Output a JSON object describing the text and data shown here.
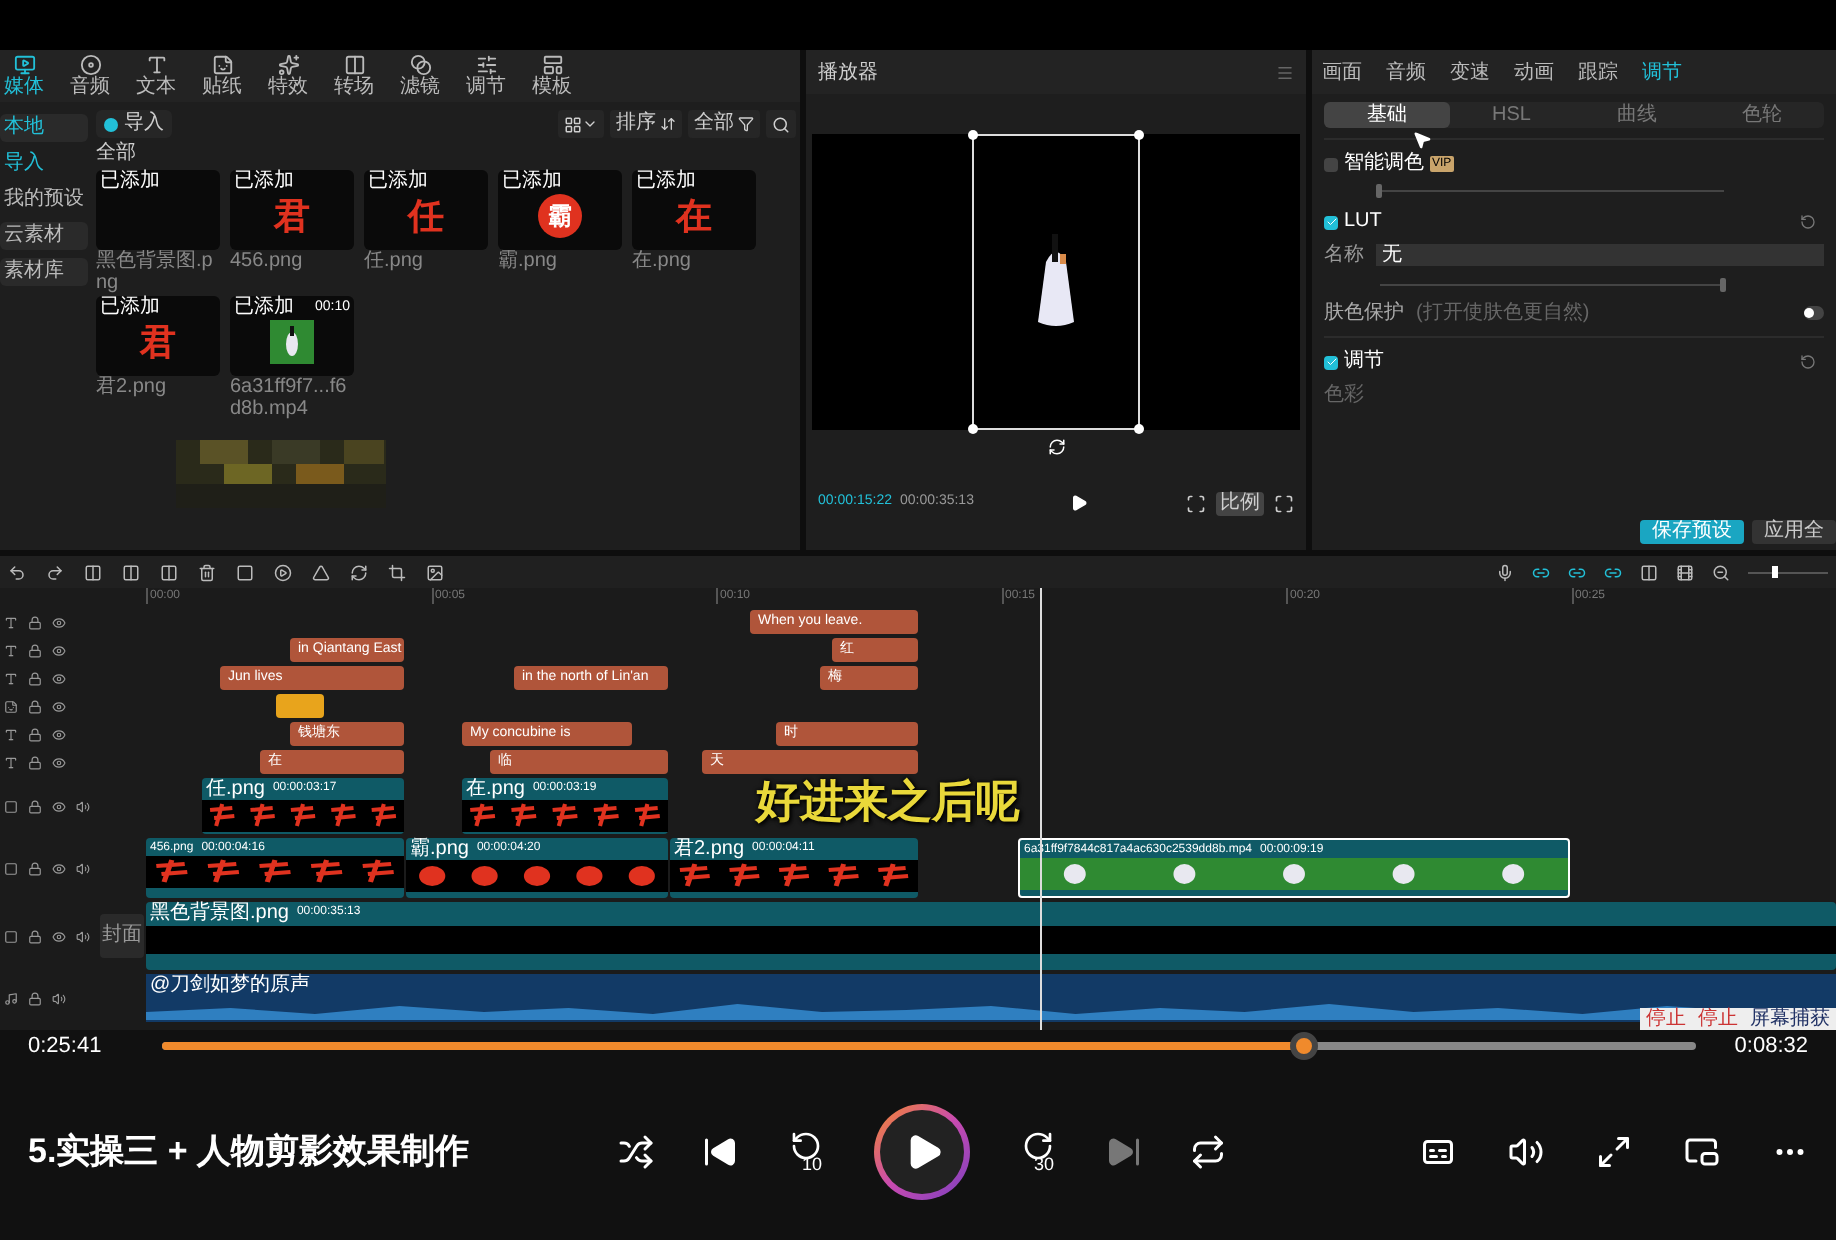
{
  "editor": {
    "media_panel": {
      "tabs": [
        {
          "label": "媒体",
          "selected": true
        },
        {
          "label": "音频",
          "selected": false
        },
        {
          "label": "文本",
          "selected": false
        },
        {
          "label": "贴纸",
          "selected": false
        },
        {
          "label": "特效",
          "selected": false
        },
        {
          "label": "转场",
          "selected": false
        },
        {
          "label": "滤镜",
          "selected": false
        },
        {
          "label": "调节",
          "selected": false
        },
        {
          "label": "模板",
          "selected": false
        }
      ],
      "sidebar": [
        {
          "label": "本地",
          "kind": "group",
          "selected": true
        },
        {
          "label": "导入",
          "kind": "item",
          "selected": true
        },
        {
          "label": "我的预设",
          "kind": "item",
          "selected": false
        },
        {
          "label": "云素材",
          "kind": "group",
          "selected": false
        },
        {
          "label": "素材库",
          "kind": "group",
          "selected": false
        }
      ],
      "import_button": "导入",
      "sort_button": "排序",
      "filter_button": "全部",
      "section_title": "全部",
      "items": [
        {
          "badge": "已添加",
          "name": "黑色背景图.png",
          "kind": "blank"
        },
        {
          "badge": "已添加",
          "name": "456.png",
          "kind": "glyph",
          "glyph": "君"
        },
        {
          "badge": "已添加",
          "name": "任.png",
          "kind": "glyph",
          "glyph": "任"
        },
        {
          "badge": "已添加",
          "name": "霸.png",
          "kind": "seal",
          "glyph": "霸"
        },
        {
          "badge": "已添加",
          "name": "在.png",
          "kind": "glyph",
          "glyph": "在"
        },
        {
          "badge": "已添加",
          "name": "君2.png",
          "kind": "glyph",
          "glyph": "君"
        },
        {
          "badge": "已添加",
          "name": "6a31ff9f7...f6d8b.mp4",
          "kind": "video",
          "duration": "00:10"
        }
      ]
    },
    "player": {
      "title": "播放器",
      "current_time": "00:00:15:22",
      "total_time": "00:00:35:13",
      "ratio_button": "比例"
    },
    "inspector": {
      "tabs": [
        {
          "label": "画面",
          "selected": false
        },
        {
          "label": "音频",
          "selected": false
        },
        {
          "label": "变速",
          "selected": false
        },
        {
          "label": "动画",
          "selected": false
        },
        {
          "label": "跟踪",
          "selected": false
        },
        {
          "label": "调节",
          "selected": true
        }
      ],
      "subtabs": [
        {
          "label": "基础",
          "selected": true
        },
        {
          "label": "HSL",
          "selected": false
        },
        {
          "label": "曲线",
          "selected": false
        },
        {
          "label": "色轮",
          "selected": false
        }
      ],
      "smart_color": {
        "label": "智能调色",
        "badge": "VIP",
        "checked": false,
        "intensity": {
          "level": 0
        }
      },
      "lut": {
        "label": "LUT",
        "checked": true,
        "name_label": "名称",
        "name_value": "无",
        "intensity": {
          "level": 1
        }
      },
      "skin": {
        "label": "肤色保护",
        "hint": "(打开使肤色更自然)",
        "on": false
      },
      "adjust": {
        "label": "调节",
        "checked": true,
        "color_label": "色彩"
      },
      "buttons": [
        {
          "label": "保存预设",
          "kind": "primary"
        },
        {
          "label": "应用全",
          "kind": "secondary"
        }
      ]
    },
    "timeline": {
      "ruler": [
        "00:00",
        "00:05",
        "00:10",
        "00:15",
        "00:20",
        "00:25"
      ],
      "zoom": {
        "level": 0.3
      },
      "tracks": [
        {
          "kind": "text",
          "clips": [
            {
              "label": "When you leave."
            }
          ]
        },
        {
          "kind": "text",
          "clips": [
            {
              "label": "in Qiantang East"
            },
            {
              "label": "红"
            }
          ]
        },
        {
          "kind": "text",
          "clips": [
            {
              "label": "Jun lives"
            },
            {
              "label": "in the north of Lin'an"
            },
            {
              "label": "梅"
            }
          ]
        },
        {
          "kind": "sticker"
        },
        {
          "kind": "text",
          "clips": [
            {
              "label": "钱塘东"
            },
            {
              "label": "My concubine is"
            },
            {
              "label": "时"
            }
          ]
        },
        {
          "kind": "text",
          "clips": [
            {
              "label": "在"
            },
            {
              "label": "临"
            },
            {
              "label": "天"
            }
          ]
        },
        {
          "kind": "overlay",
          "clips": [
            {
              "name": "任.png",
              "duration": "00:00:03:17",
              "selected": false
            },
            {
              "name": "在.png",
              "duration": "00:00:03:19",
              "selected": false
            }
          ]
        },
        {
          "kind": "main",
          "clips": [
            {
              "name": "456.png",
              "duration": "00:00:04:16",
              "selected": false
            },
            {
              "name": "霸.png",
              "duration": "00:00:04:20",
              "kind": "seal",
              "selected": false
            },
            {
              "name": "君2.png",
              "duration": "00:00:04:11",
              "selected": false
            },
            {
              "name": "6a31ff9f7844c817a4ac630c2539dd8b.mp4",
              "duration": "00:00:09:19",
              "kind": "video",
              "selected": true
            }
          ]
        },
        {
          "kind": "background",
          "cover_button": "封面",
          "clips": [
            {
              "name": "黑色背景图.png",
              "duration": "00:00:35:13",
              "kind": "blank",
              "selected": false
            }
          ]
        },
        {
          "kind": "audio",
          "clips": [
            {
              "name": "@刀剑如梦的原声"
            }
          ]
        }
      ],
      "recorder": [
        "停止",
        "停止",
        "屏幕捕获"
      ]
    },
    "subtitle": "好进来之后呢"
  },
  "video_player": {
    "elapsed": "0:25:41",
    "remaining": "0:08:32",
    "progress": {
      "level": 0.744
    },
    "title": "5.实操三 + 人物剪影效果制作",
    "rewind_label": "10",
    "forward_label": "30"
  }
}
